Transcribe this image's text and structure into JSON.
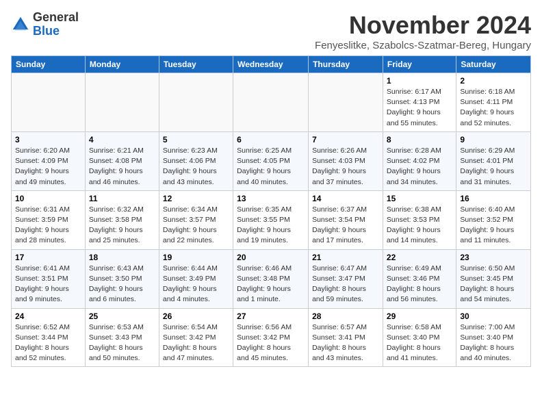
{
  "logo": {
    "general": "General",
    "blue": "Blue"
  },
  "header": {
    "month_title": "November 2024",
    "subtitle": "Fenyeslitke, Szabolcs-Szatmar-Bereg, Hungary"
  },
  "weekdays": [
    "Sunday",
    "Monday",
    "Tuesday",
    "Wednesday",
    "Thursday",
    "Friday",
    "Saturday"
  ],
  "weeks": [
    [
      {
        "day": "",
        "info": ""
      },
      {
        "day": "",
        "info": ""
      },
      {
        "day": "",
        "info": ""
      },
      {
        "day": "",
        "info": ""
      },
      {
        "day": "",
        "info": ""
      },
      {
        "day": "1",
        "info": "Sunrise: 6:17 AM\nSunset: 4:13 PM\nDaylight: 9 hours and 55 minutes."
      },
      {
        "day": "2",
        "info": "Sunrise: 6:18 AM\nSunset: 4:11 PM\nDaylight: 9 hours and 52 minutes."
      }
    ],
    [
      {
        "day": "3",
        "info": "Sunrise: 6:20 AM\nSunset: 4:09 PM\nDaylight: 9 hours and 49 minutes."
      },
      {
        "day": "4",
        "info": "Sunrise: 6:21 AM\nSunset: 4:08 PM\nDaylight: 9 hours and 46 minutes."
      },
      {
        "day": "5",
        "info": "Sunrise: 6:23 AM\nSunset: 4:06 PM\nDaylight: 9 hours and 43 minutes."
      },
      {
        "day": "6",
        "info": "Sunrise: 6:25 AM\nSunset: 4:05 PM\nDaylight: 9 hours and 40 minutes."
      },
      {
        "day": "7",
        "info": "Sunrise: 6:26 AM\nSunset: 4:03 PM\nDaylight: 9 hours and 37 minutes."
      },
      {
        "day": "8",
        "info": "Sunrise: 6:28 AM\nSunset: 4:02 PM\nDaylight: 9 hours and 34 minutes."
      },
      {
        "day": "9",
        "info": "Sunrise: 6:29 AM\nSunset: 4:01 PM\nDaylight: 9 hours and 31 minutes."
      }
    ],
    [
      {
        "day": "10",
        "info": "Sunrise: 6:31 AM\nSunset: 3:59 PM\nDaylight: 9 hours and 28 minutes."
      },
      {
        "day": "11",
        "info": "Sunrise: 6:32 AM\nSunset: 3:58 PM\nDaylight: 9 hours and 25 minutes."
      },
      {
        "day": "12",
        "info": "Sunrise: 6:34 AM\nSunset: 3:57 PM\nDaylight: 9 hours and 22 minutes."
      },
      {
        "day": "13",
        "info": "Sunrise: 6:35 AM\nSunset: 3:55 PM\nDaylight: 9 hours and 19 minutes."
      },
      {
        "day": "14",
        "info": "Sunrise: 6:37 AM\nSunset: 3:54 PM\nDaylight: 9 hours and 17 minutes."
      },
      {
        "day": "15",
        "info": "Sunrise: 6:38 AM\nSunset: 3:53 PM\nDaylight: 9 hours and 14 minutes."
      },
      {
        "day": "16",
        "info": "Sunrise: 6:40 AM\nSunset: 3:52 PM\nDaylight: 9 hours and 11 minutes."
      }
    ],
    [
      {
        "day": "17",
        "info": "Sunrise: 6:41 AM\nSunset: 3:51 PM\nDaylight: 9 hours and 9 minutes."
      },
      {
        "day": "18",
        "info": "Sunrise: 6:43 AM\nSunset: 3:50 PM\nDaylight: 9 hours and 6 minutes."
      },
      {
        "day": "19",
        "info": "Sunrise: 6:44 AM\nSunset: 3:49 PM\nDaylight: 9 hours and 4 minutes."
      },
      {
        "day": "20",
        "info": "Sunrise: 6:46 AM\nSunset: 3:48 PM\nDaylight: 9 hours and 1 minute."
      },
      {
        "day": "21",
        "info": "Sunrise: 6:47 AM\nSunset: 3:47 PM\nDaylight: 8 hours and 59 minutes."
      },
      {
        "day": "22",
        "info": "Sunrise: 6:49 AM\nSunset: 3:46 PM\nDaylight: 8 hours and 56 minutes."
      },
      {
        "day": "23",
        "info": "Sunrise: 6:50 AM\nSunset: 3:45 PM\nDaylight: 8 hours and 54 minutes."
      }
    ],
    [
      {
        "day": "24",
        "info": "Sunrise: 6:52 AM\nSunset: 3:44 PM\nDaylight: 8 hours and 52 minutes."
      },
      {
        "day": "25",
        "info": "Sunrise: 6:53 AM\nSunset: 3:43 PM\nDaylight: 8 hours and 50 minutes."
      },
      {
        "day": "26",
        "info": "Sunrise: 6:54 AM\nSunset: 3:42 PM\nDaylight: 8 hours and 47 minutes."
      },
      {
        "day": "27",
        "info": "Sunrise: 6:56 AM\nSunset: 3:42 PM\nDaylight: 8 hours and 45 minutes."
      },
      {
        "day": "28",
        "info": "Sunrise: 6:57 AM\nSunset: 3:41 PM\nDaylight: 8 hours and 43 minutes."
      },
      {
        "day": "29",
        "info": "Sunrise: 6:58 AM\nSunset: 3:40 PM\nDaylight: 8 hours and 41 minutes."
      },
      {
        "day": "30",
        "info": "Sunrise: 7:00 AM\nSunset: 3:40 PM\nDaylight: 8 hours and 40 minutes."
      }
    ]
  ]
}
